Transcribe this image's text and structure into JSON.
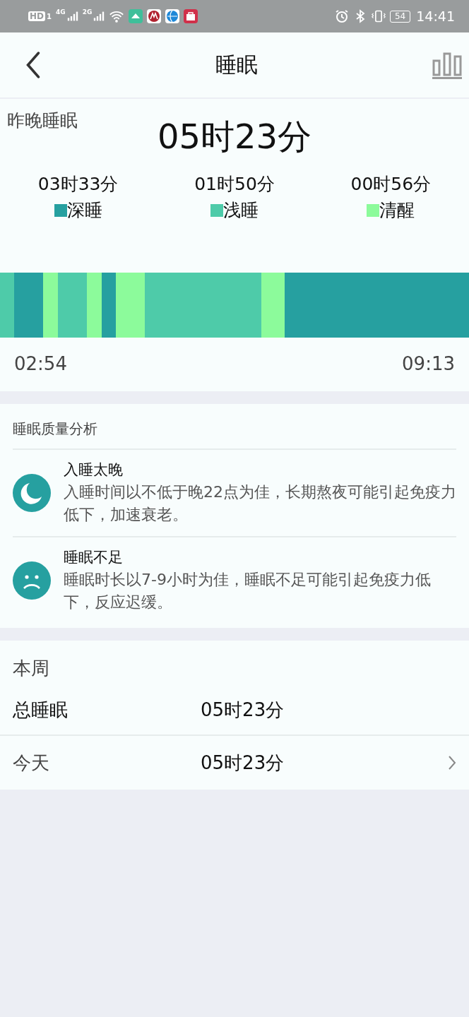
{
  "status_bar": {
    "network_badge": "HD",
    "sim": "1",
    "signal_1": "4G",
    "signal_2": "2G",
    "battery": "54",
    "time": "14:41"
  },
  "header": {
    "title": "睡眠"
  },
  "summary": {
    "label": "昨晚睡眠",
    "total": "05时23分",
    "stages": [
      {
        "kind": "deep",
        "duration": "03时33分",
        "name": "深睡",
        "color": "#26a0a0"
      },
      {
        "kind": "light",
        "duration": "01时50分",
        "name": "浅睡",
        "color": "#4ecba9"
      },
      {
        "kind": "awake",
        "duration": "00时56分",
        "name": "清醒",
        "color": "#8cfb9b"
      }
    ],
    "timeline": {
      "segments": [
        {
          "kind": "light"
        },
        {
          "kind": "deep"
        },
        {
          "kind": "awake"
        },
        {
          "kind": "light"
        },
        {
          "kind": "awake"
        },
        {
          "kind": "deep"
        },
        {
          "kind": "awake"
        },
        {
          "kind": "light"
        },
        {
          "kind": "awake"
        },
        {
          "kind": "deep"
        }
      ],
      "start": "02:54",
      "end": "09:13"
    }
  },
  "analysis": {
    "title": "睡眠质量分析",
    "items": [
      {
        "kind": "moon",
        "title": "入睡太晚",
        "text": "入睡时间以不低于晚22点为佳，长期熬夜可能引起免疫力低下，加速衰老。"
      },
      {
        "kind": "sad",
        "title": "睡眠不足",
        "text": "睡眠时长以7-9小时为佳，睡眠不足可能引起免疫力低下，反应迟缓。"
      }
    ]
  },
  "week": {
    "title": "本周",
    "rows": [
      {
        "label": "总睡眠",
        "value": "05时23分",
        "link": false
      },
      {
        "label": "今天",
        "value": "05时23分",
        "link": true
      }
    ]
  }
}
